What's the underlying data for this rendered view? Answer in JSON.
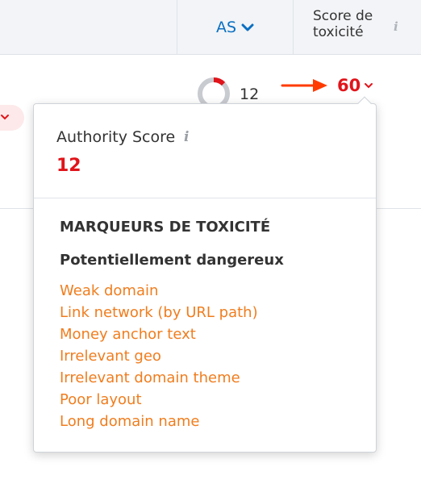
{
  "header": {
    "as_label": "AS",
    "toxicity_label": "Score de toxicité"
  },
  "row": {
    "authority_score": "12",
    "toxicity_score": "60",
    "toxicity_color": "#e0141a"
  },
  "popover": {
    "as_title": "Authority Score",
    "as_value": "12",
    "section_title": "MARQUEURS DE TOXICITÉ",
    "subtitle": "Potentiellement dangereux",
    "markers": [
      "Weak domain",
      "Link network (by URL path)",
      "Money anchor text",
      "Irrelevant geo",
      "Irrelevant domain theme",
      "Poor layout",
      "Long domain name"
    ],
    "link_color": "#f07d1e"
  },
  "icons": {
    "info": "info-icon",
    "sort": "chevron-down-icon",
    "arrow": "arrow-right-icon"
  }
}
